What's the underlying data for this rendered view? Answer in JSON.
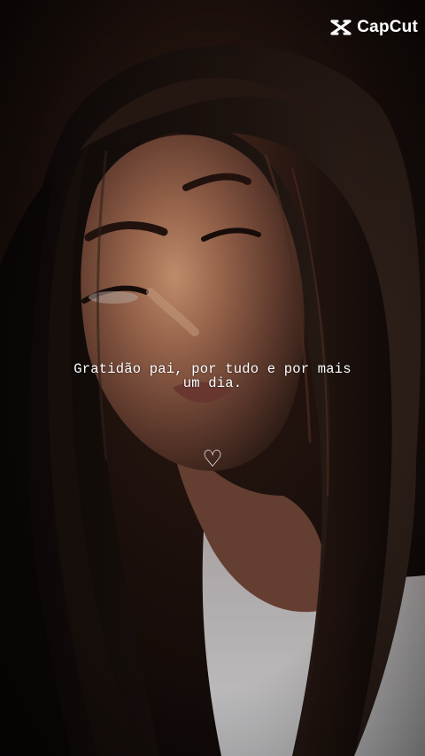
{
  "watermark": {
    "brand": "CapCut",
    "icon": "capcut-logo-icon"
  },
  "caption": {
    "line1": "Gratidão pai, por tudo e por mais",
    "line2": "um dia."
  },
  "heart": "♡",
  "colors": {
    "text": "#ffffff",
    "background": "#120c0a",
    "hair": "#1a120f",
    "skin": "#8a5a48",
    "skin_highlight": "#e2a37c",
    "shirt": "#e4e2e4"
  }
}
